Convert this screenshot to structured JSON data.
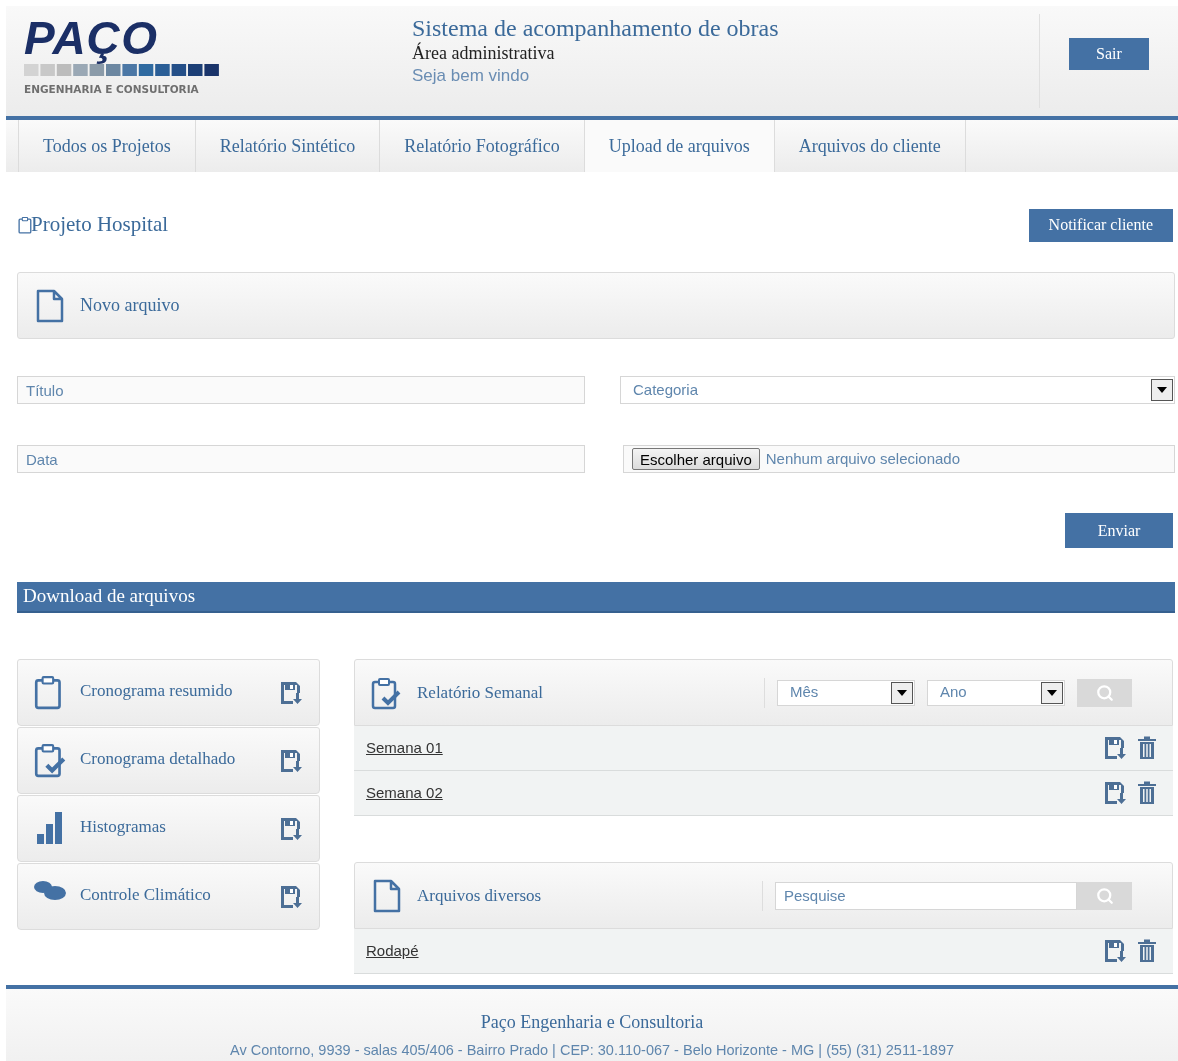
{
  "header": {
    "logo": {
      "name": "PAÇO",
      "tagline": "ENGENHARIA E CONSULTORIA"
    },
    "title": "Sistema de acompanhamento de obras",
    "subtitle": "Área administrativa",
    "welcome": "Seja bem vindo",
    "logout_button": "Sair"
  },
  "tabs": [
    {
      "label": "Todos os Projetos",
      "selected": false
    },
    {
      "label": "Relatório Sintético",
      "selected": false
    },
    {
      "label": "Relatório Fotográfico",
      "selected": false
    },
    {
      "label": "Upload de arquivos",
      "selected": true
    },
    {
      "label": "Arquivos do cliente",
      "selected": false
    }
  ],
  "project": {
    "title": "Projeto Hospital",
    "notify_button": "Notificar cliente"
  },
  "upload": {
    "panel_title": "Novo arquivo",
    "fields": [
      {
        "kind": "text",
        "placeholder": "Título"
      },
      {
        "kind": "select",
        "placeholder": "Categoria"
      },
      {
        "kind": "text",
        "placeholder": "Data"
      },
      {
        "kind": "file",
        "button": "Escolher arquivo",
        "value": "Nenhum arquivo selecionado"
      }
    ],
    "submit_button": "Enviar"
  },
  "download": {
    "title": "Download de arquivos",
    "categories": [
      {
        "label": "Cronograma resumido",
        "kind": "clipboard"
      },
      {
        "label": "Cronograma detalhado",
        "kind": "clipboard-check"
      },
      {
        "label": "Histogramas",
        "kind": "bar-chart"
      },
      {
        "label": "Controle Climático",
        "kind": "clouds"
      }
    ],
    "weekly": {
      "title": "Relatório Semanal",
      "month_placeholder": "Mês",
      "year_placeholder": "Ano",
      "files": [
        {
          "name": "Semana 01"
        },
        {
          "name": "Semana 02"
        }
      ]
    },
    "misc": {
      "title": "Arquivos diversos",
      "search_placeholder": "Pesquise",
      "files": [
        {
          "name": "Rodapé"
        }
      ]
    }
  },
  "footer": {
    "company": "Paço Engenharia e Consultoria",
    "address": "Av Contorno, 9939 - salas 405/406 - Bairro Prado | CEP: 30.110-067 - Belo Horizonte - MG | (55) (31) 2511-1897"
  }
}
